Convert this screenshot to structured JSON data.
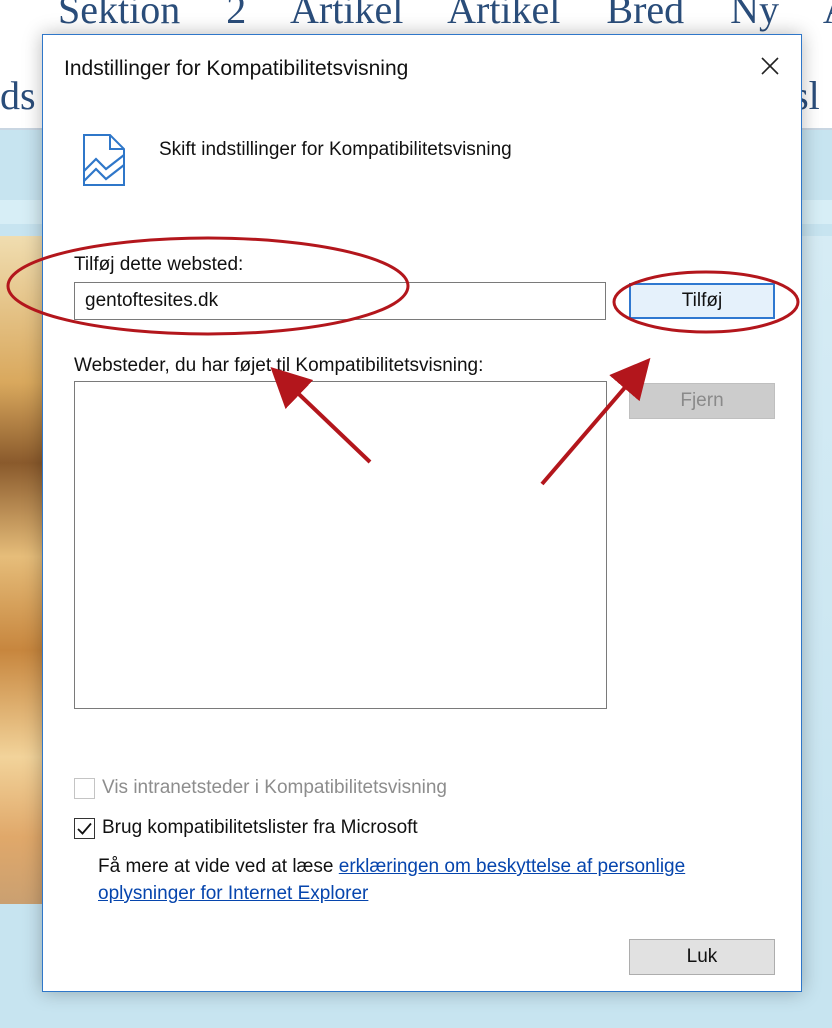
{
  "background": {
    "nav_row1": "Sektion 2 Artikel Artikel Bred Ny A",
    "nav_row2_left": "ds",
    "nav_row2_right": "tsl"
  },
  "dialog": {
    "title": "Indstillinger for Kompatibilitetsvisning",
    "header_text": "Skift indstillinger for Kompatibilitetsvisning",
    "add_site_label": "Tilføj dette websted:",
    "add_site_value": "gentoftesites.dk",
    "add_button": "Tilføj",
    "sites_list_label": "Websteder, du har føjet til Kompatibilitetsvisning:",
    "sites_list_items": [],
    "remove_button": "Fjern",
    "intranet_checkbox": {
      "label": "Vis intranetsteder i Kompatibilitetsvisning",
      "checked": false,
      "enabled": false
    },
    "mslist_checkbox": {
      "label": "Brug kompatibilitetslister fra Microsoft",
      "checked": true,
      "enabled": true
    },
    "info_prefix": "Få mere at vide ved at læse ",
    "info_link": "erklæringen om beskyttelse af personlige oplysninger for Internet Explorer",
    "close_button": "Luk"
  },
  "colors": {
    "accent_border": "#2f77c9",
    "annotation_red": "#b3161c",
    "page_band": "#c7e4f0"
  },
  "icons": {
    "close": "close-x-icon",
    "header": "compatibility-view-icon",
    "check": "checkmark-icon"
  }
}
